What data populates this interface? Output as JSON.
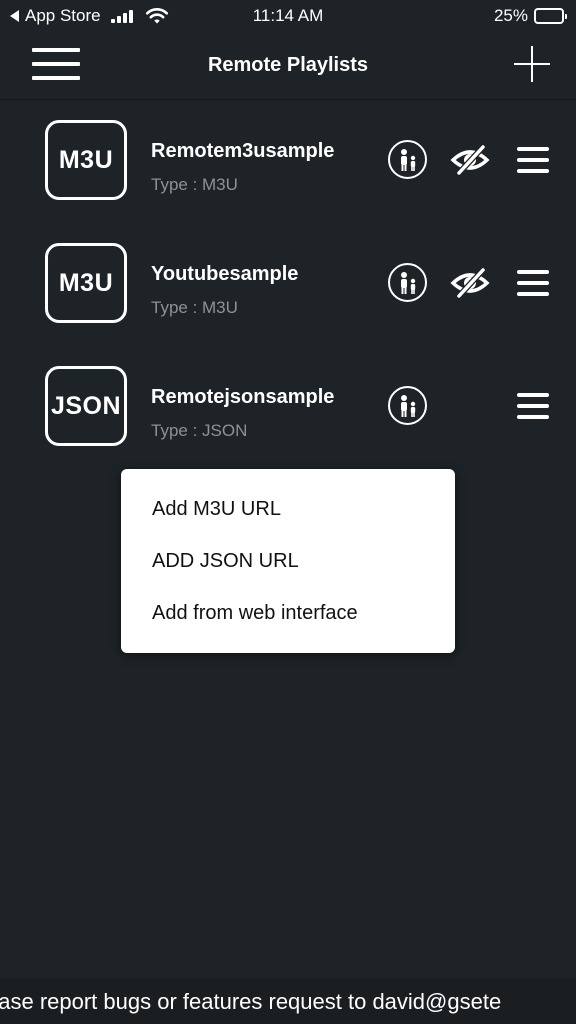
{
  "status_bar": {
    "back_label": "App Store",
    "time": "11:14 AM",
    "battery": "25%",
    "battery_level": 0.25
  },
  "nav": {
    "title": "Remote Playlists",
    "menu_icon": "hamburger-icon",
    "add_icon": "plus-icon"
  },
  "playlists": [
    {
      "badge": "M3U",
      "name": "Remotem3usample",
      "type": "Type : M3U",
      "has_eye": true
    },
    {
      "badge": "M3U",
      "name": "Youtubesample",
      "type": "Type : M3U",
      "has_eye": true
    },
    {
      "badge": "JSON",
      "name": "Remotejsonsample",
      "type": "Type : JSON",
      "has_eye": false
    }
  ],
  "popup_menu": {
    "items": [
      "Add M3U URL",
      "ADD JSON URL",
      "Add from web interface"
    ]
  },
  "footer": {
    "ticker": "ease report bugs or features request to david@gsete"
  },
  "colors": {
    "background": "#1e2327",
    "subtitle": "#8e9296",
    "battery_fill": "#f5c518"
  }
}
